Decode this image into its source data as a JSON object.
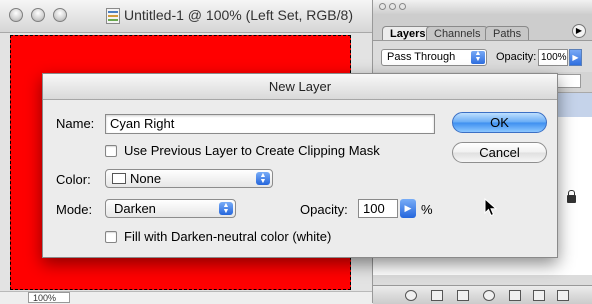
{
  "document": {
    "title": "Untitled-1 @ 100% (Left Set, RGB/8)",
    "zoom": "100%",
    "canvas_color": "#ff0000"
  },
  "layers_palette": {
    "tabs": [
      {
        "label": "Layers",
        "active": true
      },
      {
        "label": "Channels",
        "active": false
      },
      {
        "label": "Paths",
        "active": false
      }
    ],
    "blend_mode": "Pass Through",
    "opacity_label": "Opacity:",
    "opacity_value": "100%"
  },
  "dialog": {
    "title": "New Layer",
    "name_label": "Name:",
    "name_value": "Cyan Right",
    "clipping_mask_label": "Use Previous Layer to Create Clipping Mask",
    "clipping_mask_checked": false,
    "color_label": "Color:",
    "color_value": "None",
    "mode_label": "Mode:",
    "mode_value": "Darken",
    "opacity_label": "Opacity:",
    "opacity_value": "100",
    "opacity_unit": "%",
    "fill_neutral_label": "Fill with Darken-neutral color (white)",
    "fill_neutral_checked": false,
    "ok_label": "OK",
    "cancel_label": "Cancel"
  },
  "icons": {
    "window_controls": [
      "close-icon",
      "minimize-icon",
      "zoom-icon"
    ],
    "document_icon": "document-icon",
    "lock_icon": "lock-icon",
    "cursor": "arrow-cursor-icon"
  },
  "colors": {
    "accent_blue": "#3e8ff0",
    "selected_layer": "#c5d3ea"
  }
}
